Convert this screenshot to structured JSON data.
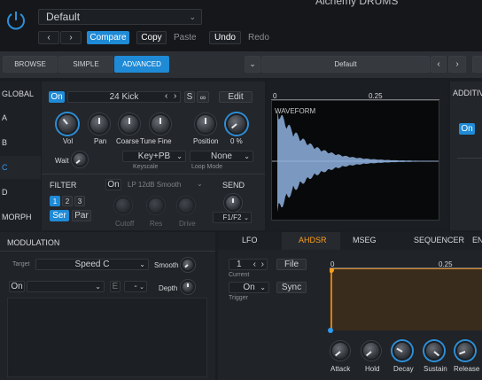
{
  "header": {
    "preset_name": "Default",
    "app_title": "Alchemy DRUMS",
    "compare_label": "Compare",
    "copy_label": "Copy",
    "paste_label": "Paste",
    "undo_label": "Undo",
    "redo_label": "Redo"
  },
  "mode_tabs": {
    "browse": "BROWSE",
    "simple": "SIMPLE",
    "advanced": "ADVANCED"
  },
  "preset_bar": {
    "value": "Default"
  },
  "side_tabs": {
    "global": "GLOBAL",
    "a": "A",
    "b": "B",
    "c": "C",
    "d": "D",
    "morph": "MORPH"
  },
  "source": {
    "on_label": "On",
    "name": "24 Kick",
    "s_label": "S",
    "edit_label": "Edit",
    "vol_label": "Vol",
    "pan_label": "Pan",
    "coarse_label": "Coarse",
    "tune_label": "Tune",
    "fine_label": "Fine",
    "position_label": "Position",
    "percent_label": "0 %",
    "wait_label": "Wait",
    "keyscale_value": "Key+PB",
    "keyscale_label": "Keyscale",
    "loopmode_value": "None",
    "loopmode_label": "Loop Mode"
  },
  "filter": {
    "title": "FILTER",
    "on_label": "On",
    "type": "LP 12dB Smooth",
    "n1": "1",
    "n2": "2",
    "n3": "3",
    "ser_label": "Ser",
    "par_label": "Par",
    "cutoff_label": "Cutoff",
    "res_label": "Res",
    "drive_label": "Drive"
  },
  "send": {
    "title": "SEND",
    "value": "F1/F2"
  },
  "waveform": {
    "start": "0",
    "mid": "0.25",
    "label": "WAVEFORM"
  },
  "additive": {
    "title": "ADDITIV",
    "on_label": "On"
  },
  "modulation": {
    "title": "MODULATION",
    "target_label": "Target",
    "target_value": "Speed C",
    "smooth_label": "Smooth",
    "on_label": "On",
    "e_label": "E",
    "depth_label": "Depth"
  },
  "env_tabs": {
    "lfo": "LFO",
    "ahdsr": "AHDSR",
    "mseg": "MSEG",
    "sequencer": "SEQUENCER",
    "en": "EN"
  },
  "envelope": {
    "current_value": "1",
    "current_label": "Current",
    "file_label": "File",
    "trigger_value": "On",
    "trigger_label": "Trigger",
    "sync_label": "Sync",
    "axis_start": "0",
    "axis_mid": "0.25",
    "attack_label": "Attack",
    "hold_label": "Hold",
    "decay_label": "Decay",
    "sustain_label": "Sustain",
    "release_label": "Release"
  },
  "colors": {
    "accent": "#1f8ad6",
    "env_orange": "#ff9d1c",
    "wave_blue": "#8fb3e0"
  }
}
